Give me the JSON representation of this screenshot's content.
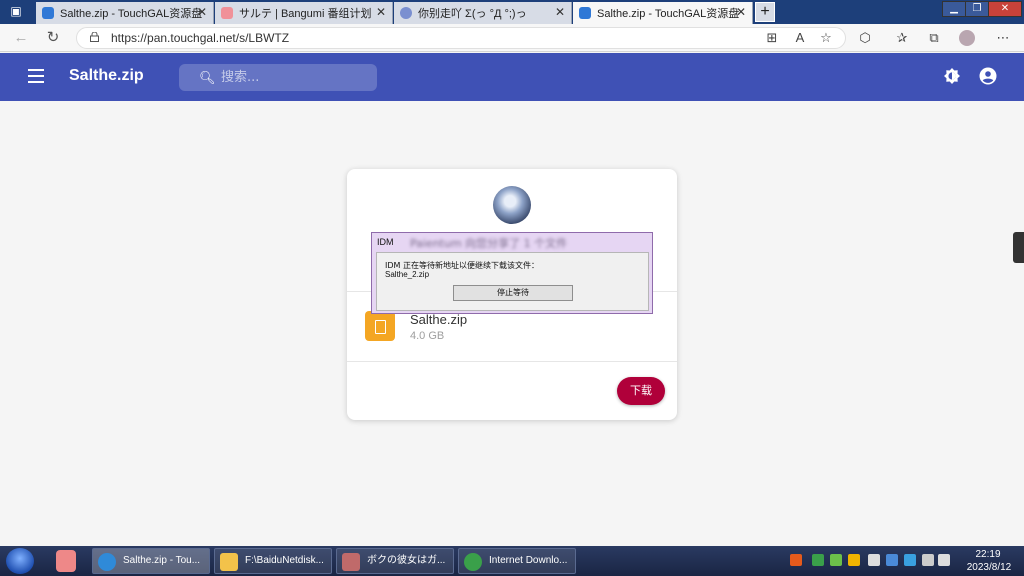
{
  "browser": {
    "tabs": [
      {
        "title": "Salthe.zip - TouchGAL资源盘",
        "icon": "edge-cloud-icon"
      },
      {
        "title": "サルテ | Bangumi 番组计划",
        "icon": "bangumi-icon"
      },
      {
        "title": "你别走吖 Σ(っ °Д °;)っ",
        "icon": "cloud-icon"
      },
      {
        "title": "Salthe.zip - TouchGAL资源盘",
        "icon": "edge-cloud-icon"
      }
    ],
    "close_glyph": "✕",
    "new_tab_glyph": "+",
    "url": "https://pan.touchgal.net/s/LBWTZ"
  },
  "app": {
    "title": "Salthe.zip",
    "search_placeholder": "搜索...",
    "header_color": "#3f51b5"
  },
  "card": {
    "file_name": "Salthe.zip",
    "file_size": "4.0 GB",
    "download_label": "下载",
    "download_color": "#b0003a",
    "file_icon_color": "#f4a623"
  },
  "idm": {
    "title": "IDM",
    "blurred_text": "Paientum 向您分享了 1 个文件",
    "message": "IDM 正在等待新地址以便继续下载该文件：",
    "file": "Salthe_2.zip",
    "stop_label": "停止等待"
  },
  "taskbar": {
    "items": [
      {
        "label": "Salthe.zip - Tou...",
        "icon": "edge-icon"
      },
      {
        "label": "F:\\BaiduNetdisk...",
        "icon": "folder-icon"
      },
      {
        "label": "ボクの彼女はガ...",
        "icon": "game-icon"
      },
      {
        "label": "Internet Downlo...",
        "icon": "idm-icon"
      }
    ],
    "time": "22:19",
    "date": "2023/8/12"
  }
}
